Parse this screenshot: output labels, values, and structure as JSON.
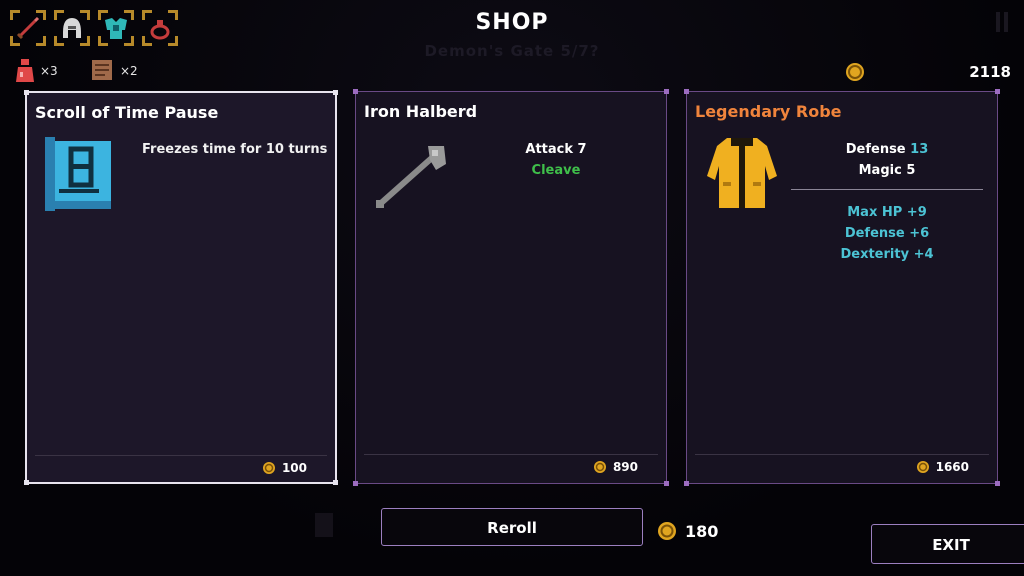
{
  "header": {
    "title": "SHOP",
    "background_level": "Demon's Gate 5/7?"
  },
  "equipment_slots": [
    {
      "icon": "sword-icon"
    },
    {
      "icon": "helmet-icon"
    },
    {
      "icon": "armor-icon"
    },
    {
      "icon": "ring-icon"
    }
  ],
  "consumables": {
    "potion_count": "×3",
    "scroll_count": "×2"
  },
  "gold": {
    "amount": "2118"
  },
  "shop_items": [
    {
      "name": "Scroll of Time Pause",
      "description": "Freezes time for 10 turns",
      "price": "100",
      "icon": "scroll-icon"
    },
    {
      "name": "Iron Halberd",
      "stat_label": "Attack",
      "stat_value": "7",
      "perk": "Cleave",
      "price": "890",
      "icon": "halberd-icon"
    },
    {
      "name": "Legendary Robe",
      "defense_label": "Defense",
      "defense_value": "13",
      "magic": "Magic 5",
      "bonuses": [
        "Max HP +9",
        "Defense +6",
        "Dexterity +4"
      ],
      "price": "1660",
      "icon": "robe-icon"
    }
  ],
  "actions": {
    "reroll_label": "Reroll",
    "reroll_cost": "180",
    "exit_label": "EXIT"
  },
  "colors": {
    "legendary": "#f0843c",
    "perk": "#3fbf4a",
    "bonus": "#4cc3d4",
    "card_border": "#6a4a86"
  }
}
